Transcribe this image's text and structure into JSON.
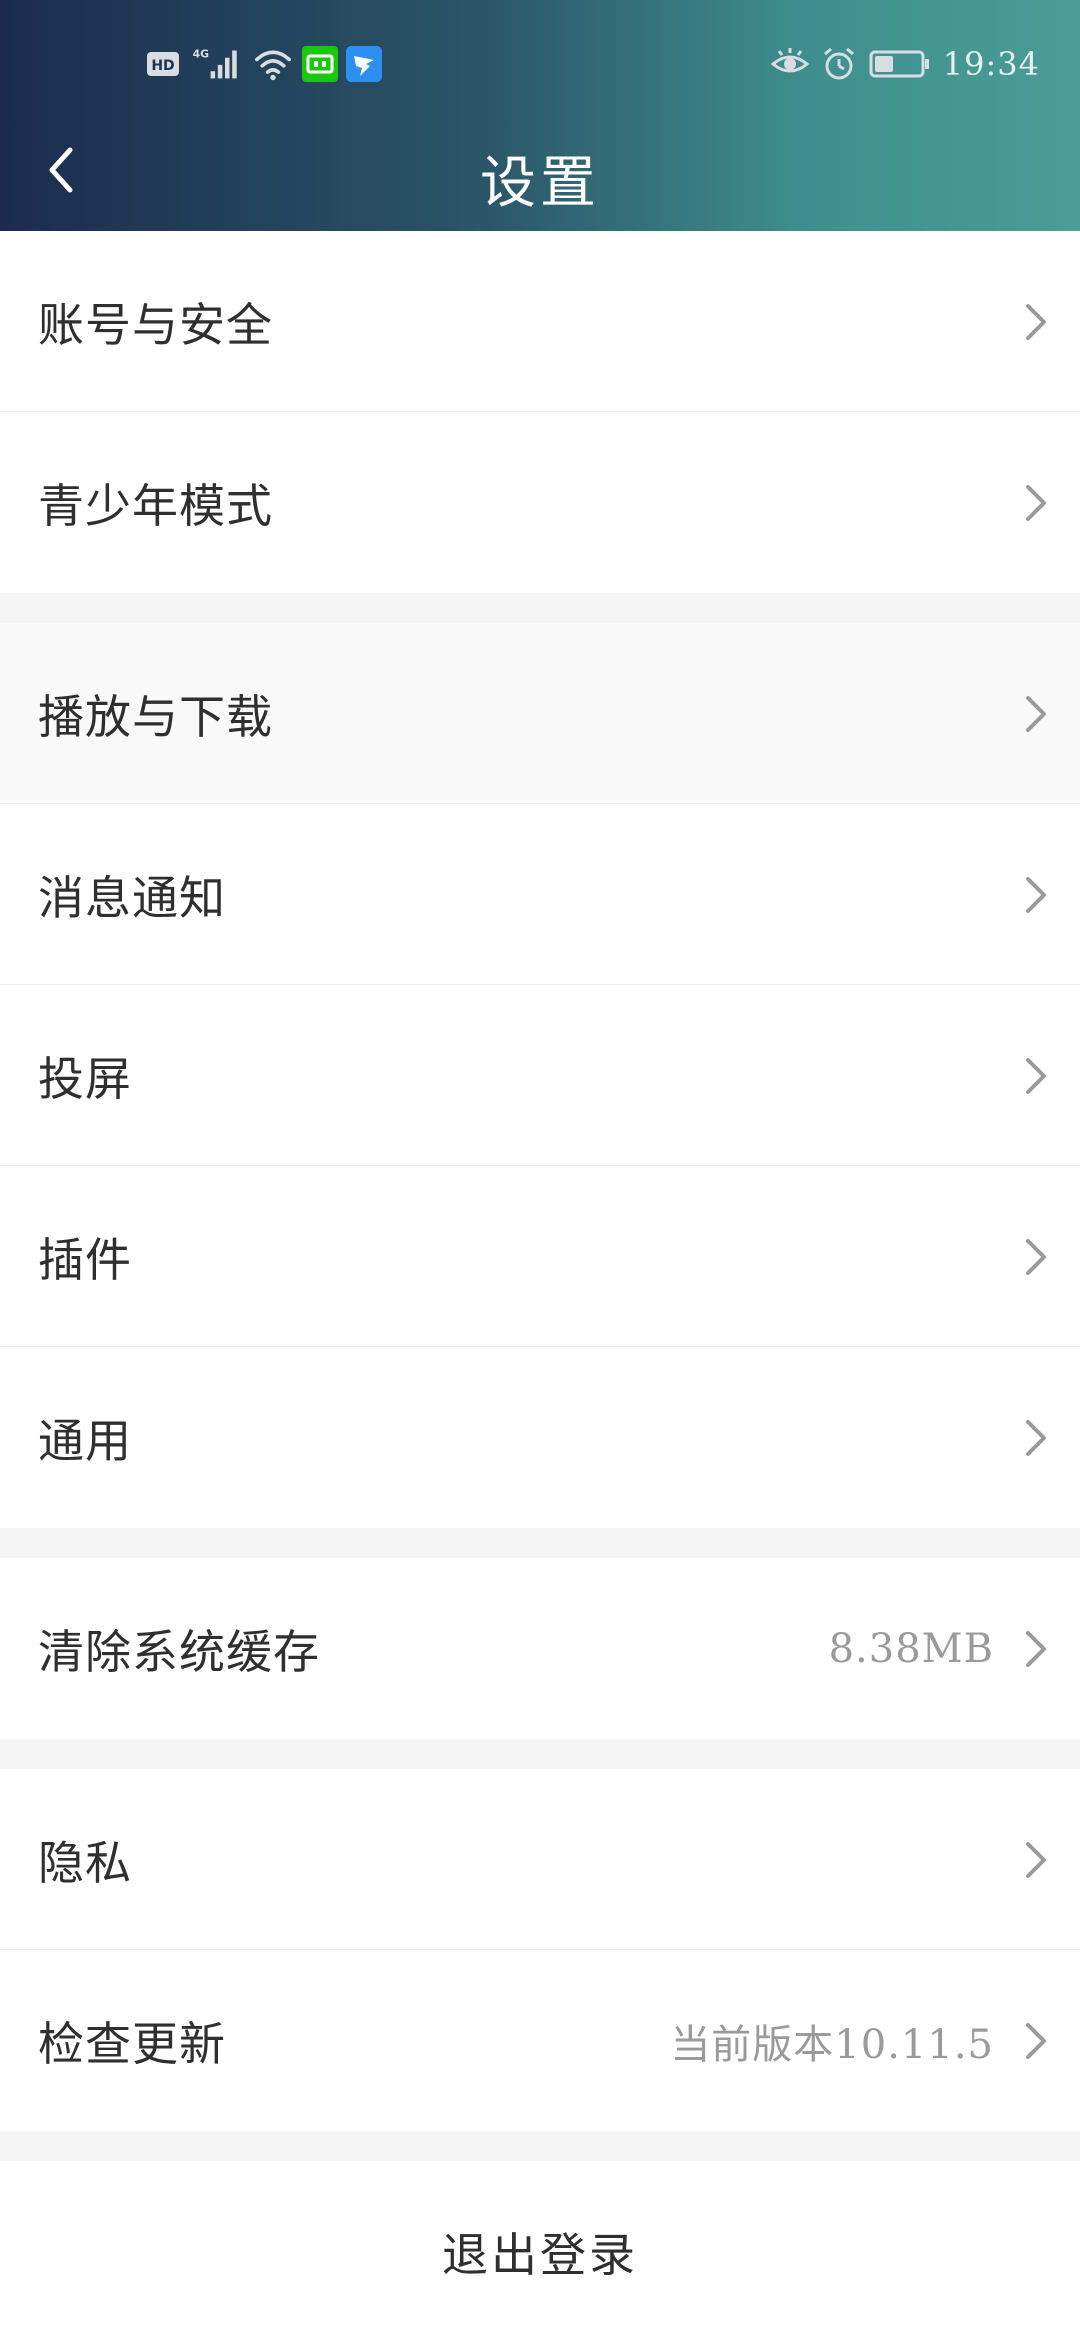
{
  "status_bar": {
    "time": "19:34",
    "hd_badge": "HD",
    "network": "4G",
    "icons": {
      "hd": "hd-badge-icon",
      "signal": "cellular-signal-icon",
      "wifi": "wifi-icon",
      "app1": "iqiyi-app-icon",
      "app2": "dingtalk-app-icon",
      "eye": "eye-comfort-icon",
      "alarm": "alarm-icon",
      "battery": "battery-icon"
    }
  },
  "header": {
    "title": "设置",
    "back_icon": "chevron-left-icon"
  },
  "settings": {
    "account_security": "账号与安全",
    "teen_mode": "青少年模式",
    "play_download": "播放与下载",
    "notifications": "消息通知",
    "screen_cast": "投屏",
    "plugins": "插件",
    "general": "通用",
    "clear_cache": "清除系统缓存",
    "cache_size": "8.38MB",
    "privacy": "隐私",
    "check_update": "检查更新",
    "current_version": "当前版本10.11.5"
  },
  "logout_label": "退出登录",
  "colors": {
    "header_start": "#1b2c4d",
    "header_end": "#4a9e95",
    "text_primary": "#2f2f2f",
    "text_secondary": "#9a9a9a",
    "section_gap": "#f5f5f5",
    "chevron": "#9a9a9a"
  }
}
